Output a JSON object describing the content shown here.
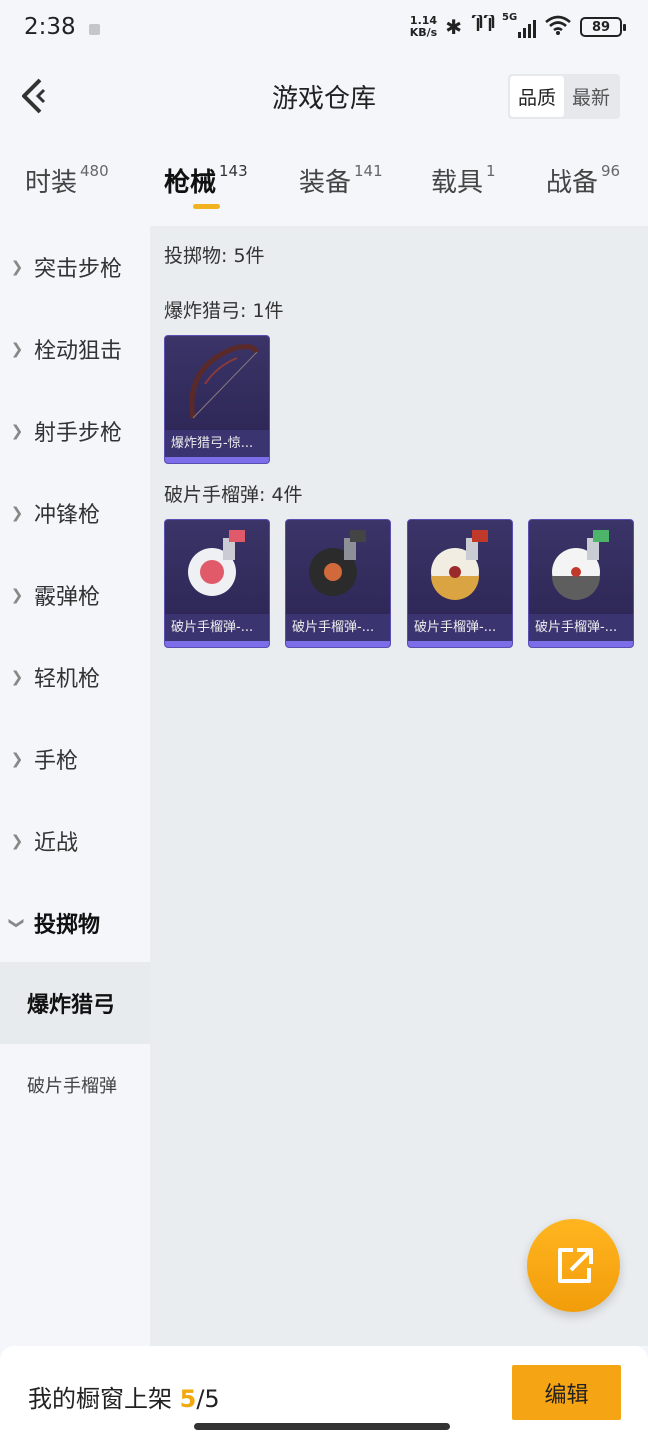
{
  "status": {
    "time": "2:38",
    "net_speed_value": "1.14",
    "net_speed_unit": "KB/s",
    "signal_label": "5G",
    "battery": "89"
  },
  "header": {
    "title": "游戏仓库",
    "sort_options": [
      "品质",
      "最新"
    ],
    "sort_active": "品质"
  },
  "tabs": [
    {
      "label": "时装",
      "count": "480"
    },
    {
      "label": "枪械",
      "count": "143"
    },
    {
      "label": "装备",
      "count": "141"
    },
    {
      "label": "载具",
      "count": "1"
    },
    {
      "label": "战备",
      "count": "96"
    }
  ],
  "active_tab": "枪械",
  "sidebar": {
    "categories": [
      "突击步枪",
      "栓动狙击",
      "射手步枪",
      "冲锋枪",
      "霰弹枪",
      "轻机枪",
      "手枪",
      "近战",
      "投掷物"
    ],
    "open_category": "投掷物",
    "subcategories": [
      "爆炸猎弓",
      "破片手榴弹"
    ],
    "active_subcategory": "爆炸猎弓"
  },
  "content": {
    "summary": "投掷物: 5件",
    "sections": [
      {
        "title": "爆炸猎弓: 1件",
        "items": [
          {
            "name": "爆炸猎弓-惊...",
            "icon": "bow-icon"
          }
        ]
      },
      {
        "title": "破片手榴弹: 4件",
        "items": [
          {
            "name": "破片手榴弹-...",
            "icon": "grenade-icon",
            "color": "#e05a6a"
          },
          {
            "name": "破片手榴弹-...",
            "icon": "grenade-icon",
            "color": "#222222"
          },
          {
            "name": "破片手榴弹-...",
            "icon": "grenade-icon",
            "color": "#d9a441"
          },
          {
            "name": "破片手榴弹-...",
            "icon": "grenade-icon",
            "color": "#4cb56a"
          }
        ]
      }
    ]
  },
  "bottom": {
    "shelf_label": "我的橱窗上架",
    "shelf_current": "5",
    "shelf_total": "/5",
    "edit_label": "编辑"
  },
  "colors": {
    "accent": "#f5a414",
    "card_bg": "#2a2452",
    "card_bar": "#7b6ee8"
  }
}
